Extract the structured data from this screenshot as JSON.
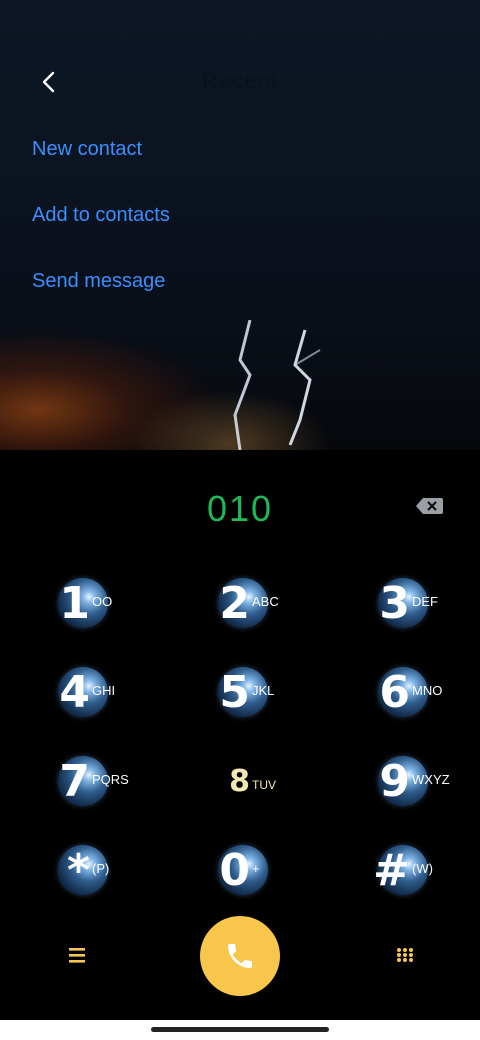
{
  "header": {
    "title": "Recent"
  },
  "actions": [
    "New contact",
    "Add to contacts",
    "Send message"
  ],
  "dialed_number": "010",
  "keypad": [
    {
      "digit": "1",
      "letters": "OO"
    },
    {
      "digit": "2",
      "letters": "ABC"
    },
    {
      "digit": "3",
      "letters": "DEF"
    },
    {
      "digit": "4",
      "letters": "GHI"
    },
    {
      "digit": "5",
      "letters": "JKL"
    },
    {
      "digit": "6",
      "letters": "MNO"
    },
    {
      "digit": "7",
      "letters": "PQRS"
    },
    {
      "digit": "8",
      "letters": "TUV"
    },
    {
      "digit": "9",
      "letters": "WXYZ"
    },
    {
      "digit": "*",
      "letters": "(P)"
    },
    {
      "digit": "0",
      "letters": "+"
    },
    {
      "digit": "#",
      "letters": "(W)"
    }
  ],
  "icons": {
    "back": "chevron-left-icon",
    "delete": "backspace-icon",
    "menu": "hamburger-menu-icon",
    "call": "phone-icon",
    "keypad": "dialpad-icon"
  },
  "colors": {
    "accent_link": "#3a8fff",
    "number_green": "#1fb856",
    "call_yellow": "#f7c64a"
  }
}
